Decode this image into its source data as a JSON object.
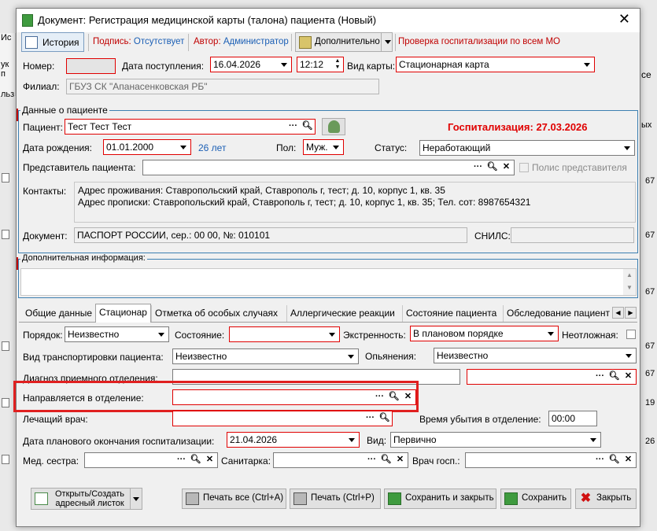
{
  "window": {
    "title": "Документ: Регистрация медицинской карты (талона) пациента (Новый)"
  },
  "toolbar": {
    "history": "История",
    "signature": "Подпись: Отсутствует",
    "author": "Автор: Администратор",
    "extra": "Дополнительно",
    "check": "Проверка госпитализации по всем МО"
  },
  "top": {
    "number_label": "Номер:",
    "date_label": "Дата поступления:",
    "date_value": "16.04.2026",
    "time_value": "12:12",
    "cardtype_label": "Вид карты:",
    "cardtype_value": "Стационарная карта",
    "branch_label": "Филиал:",
    "branch_value": "ГБУЗ СК \"Апанасенковская РБ\""
  },
  "patient": {
    "group_title": "Данные о пациенте",
    "patient_label": "Пациент:",
    "patient_value": "Тест Тест Тест",
    "hosp_status": "Госпитализация: 27.03.2026",
    "birth_label": "Дата рождения:",
    "birth_value": "01.01.2000",
    "age": "26 лет",
    "sex_label": "Пол:",
    "sex_value": "Муж.",
    "status_label": "Статус:",
    "status_value": "Неработающий",
    "rep_label": "Представитель пациента:",
    "rep_policy": "Полис представителя",
    "contacts_label": "Контакты:",
    "contacts_line1": "Адрес проживания: Ставропольский край, Ставрополь г, тест; д. 10, корпус 1, кв. 35",
    "contacts_line2": "Адрес прописки: Ставропольский край, Ставрополь г, тест; д. 10, корпус 1, кв. 35; Тел. сот: 8987654321",
    "doc_label": "Документ:",
    "doc_value": "ПАСПОРТ РОССИИ, сер.: 00 00, №: 010101",
    "snils_label": "СНИЛС:"
  },
  "additional": {
    "title": "Дополнительная информация:"
  },
  "tabs": [
    "Общие данные",
    "Стационар",
    "Отметка об особых случаях",
    "Аллергические реакции",
    "Состояние пациента",
    "Обследование пациент"
  ],
  "hospital": {
    "order_label": "Порядок:",
    "order_value": "Неизвестно",
    "state_label": "Состояние:",
    "urgency_label": "Экстренность:",
    "urgency_value": "В плановом порядке",
    "nonurgent_label": "Неотложная:",
    "transport_label": "Вид транспортировки пациента:",
    "transport_value": "Неизвестно",
    "intox_label": "Опьянения:",
    "intox_value": "Неизвестно",
    "diag_label": "Диагноз приемного отделения:",
    "dept_label": "Направляется в отделение:",
    "doctor_label": "Лечащий врач:",
    "leave_time_label": "Время убытия в отделение:",
    "leave_time_value": "00:00",
    "plan_end_label": "Дата планового окончания госпитализации:",
    "plan_end_value": "21.04.2026",
    "kind_label": "Вид:",
    "kind_value": "Первично",
    "nurse_label": "Мед. сестра:",
    "orderly_label": "Санитарка:",
    "hosp_doctor_label": "Врач госп.:"
  },
  "buttons": {
    "open_line1": "Открыть/Создать",
    "open_line2": "адресный листок",
    "print_all": "Печать все (Ctrl+A)",
    "print": "Печать (Ctrl+P)",
    "save_close": "Сохранить и закрыть",
    "save": "Сохранить",
    "close": "Закрыть"
  },
  "background": {
    "left_frag": [
      "Ис",
      "ук п",
      "льз"
    ],
    "right_nums": [
      "67",
      "67",
      "67",
      "67",
      "67",
      "19",
      "26"
    ],
    "right_frag": [
      "се",
      "ых"
    ]
  },
  "colors": {
    "accent_red": "#e00000",
    "group_blue": "#3c7fb1",
    "highlight": "#e02020",
    "age_blue": "#1b5fb5"
  }
}
